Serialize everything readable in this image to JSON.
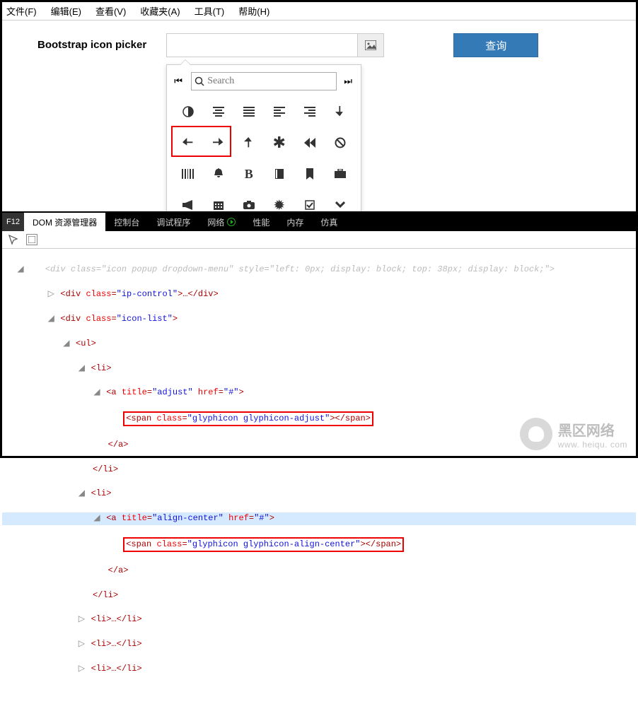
{
  "menubar": [
    "文件(F)",
    "编辑(E)",
    "查看(V)",
    "收藏夹(A)",
    "工具(T)",
    "帮助(H)"
  ],
  "picker": {
    "label": "Bootstrap icon picker",
    "input_value": "",
    "search_placeholder": "Search",
    "query_btn": "查询",
    "icons": [
      "adjust",
      "align-center",
      "align-justify",
      "align-left",
      "align-right",
      "arrow-down",
      "arrow-left",
      "arrow-right",
      "arrow-up",
      "asterisk",
      "backward",
      "ban-circle",
      "barcode",
      "bell",
      "bold",
      "book",
      "bookmark",
      "briefcase",
      "bullhorn",
      "calendar",
      "camera",
      "certificate",
      "check",
      "chevron-down"
    ]
  },
  "devtools": {
    "f12": "F12",
    "tabs": [
      "DOM 资源管理器",
      "控制台",
      "调试程序",
      "网络",
      "性能",
      "内存",
      "仿真"
    ],
    "active_tab": 0,
    "truncated_line": "<div class=\"icon popup dropdown-menu\" style=\"left: 0px; display: block; top: 38px; display: block;\">",
    "code": {
      "line1": {
        "open": "<div ",
        "a": "class",
        "v": "\"ip-control\"",
        "rest": ">…</div>"
      },
      "line2": {
        "open": "<div ",
        "a": "class",
        "v": "\"icon-list\"",
        "rest": ">"
      },
      "ul": "<ul>",
      "li": "<li>",
      "a1": {
        "open": "<a ",
        "a1": "title",
        "v1": "\"adjust\"",
        "a2": "href",
        "v2": "\"#\"",
        "rest": ">"
      },
      "span1": {
        "open": "<span ",
        "a": "class",
        "v": "\"glyphicon glyphicon-adjust\"",
        "rest": "></span>"
      },
      "a2": {
        "open": "<a ",
        "a1": "title",
        "v1": "\"align-center\"",
        "a2": "href",
        "v2": "\"#\"",
        "rest": ">"
      },
      "span2": {
        "open": "<span ",
        "a": "class",
        "v": "\"glyphicon glyphicon-align-center\"",
        "rest": "></span>"
      },
      "close_a": "</a>",
      "close_li": "</li>",
      "li_ellipsis": "<li>…</li>"
    }
  },
  "watermark": {
    "t1": "黑区网络",
    "t2": "www. heiqu. com"
  }
}
